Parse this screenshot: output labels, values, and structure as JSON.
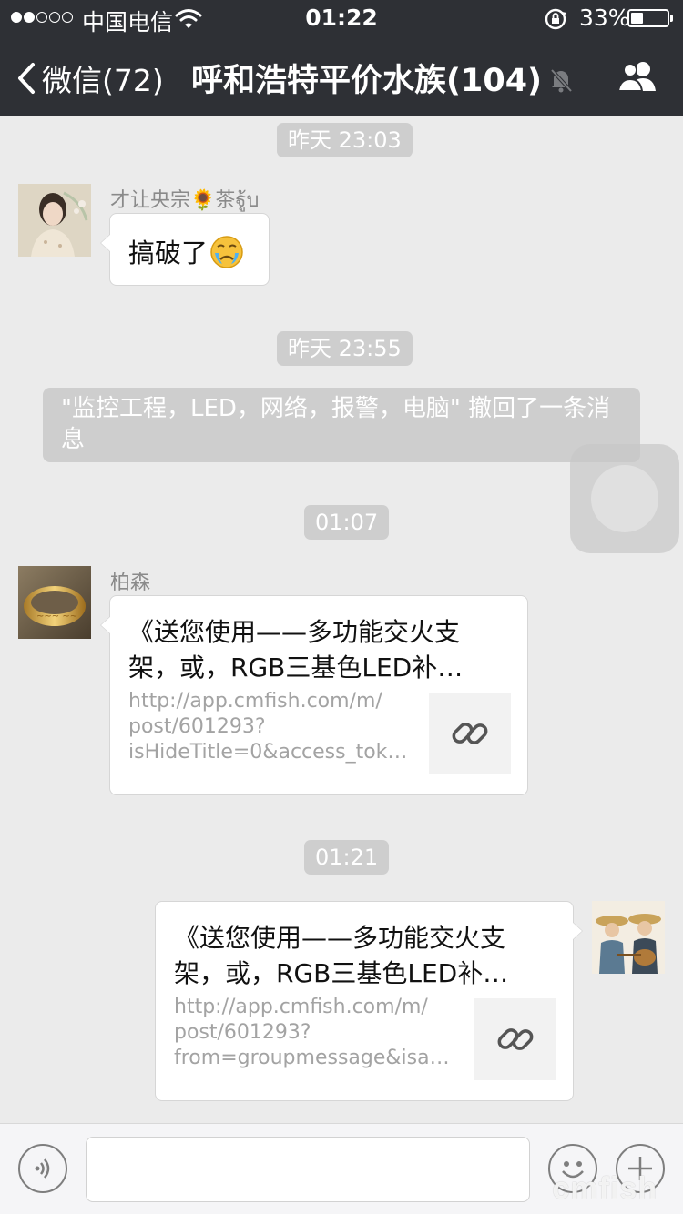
{
  "status_bar": {
    "carrier": "中国电信",
    "time": "01:22",
    "battery_percent": "33%",
    "battery_level": 0.33
  },
  "nav": {
    "back_label": "微信(72)",
    "title": "呼和浩特平价水族(104)",
    "icons": [
      "chevron-left-icon",
      "mute-bell-icon",
      "group-members-icon"
    ]
  },
  "chat": {
    "timestamps": [
      "昨天 23:03",
      "昨天 23:55",
      "01:07",
      "01:21"
    ],
    "msg1": {
      "sender": "才让央宗🌻茶ฐู้บ",
      "text": "搞破了"
    },
    "system_notice": "\"监控工程，LED，网络，报警，电脑\" 撤回了一条消息",
    "msg2": {
      "sender": "柏森",
      "link_title": "《送您使用——多功能交火支架，或，RGB三基色LED补…",
      "link_url_lines": [
        "http://app.cmfish.com/m/",
        "post/601293?",
        "isHideTitle=0&access_tok…"
      ]
    },
    "msg3": {
      "link_title": "《送您使用——多功能交火支架，或，RGB三基色LED补…",
      "link_url_lines": [
        "http://app.cmfish.com/m/",
        "post/601293?",
        "from=groupmessage&isa…"
      ]
    }
  },
  "input_bar": {
    "icons": [
      "voice-icon",
      "emoji-icon",
      "plus-icon"
    ]
  },
  "watermark": "cmfish",
  "colors": {
    "nav_bg": "#2e3035",
    "chat_bg": "#ebebeb",
    "timestamp_bg": "#cecece"
  }
}
